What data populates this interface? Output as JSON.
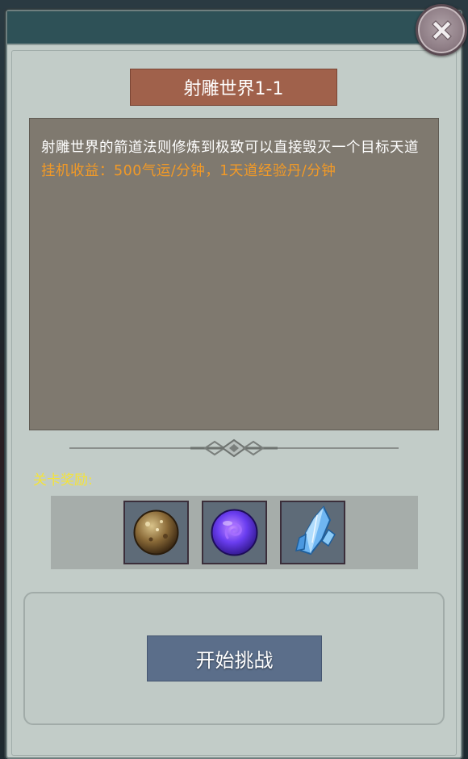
{
  "dialog": {
    "title": "射雕世界1-1",
    "description": "射雕世界的箭道法则修炼到极致可以直接毁灭一个目标天道",
    "income": "挂机收益：500气运/分钟，1天道经验丹/分钟",
    "reward_label": "关卡奖励:",
    "rewards": [
      {
        "icon": "bronze-orb-icon"
      },
      {
        "icon": "purple-orb-icon"
      },
      {
        "icon": "ice-crystal-icon"
      }
    ],
    "start_button": "开始挑战",
    "close_icon": "close-icon"
  },
  "colors": {
    "title_bg": "#a0614b",
    "income_text": "#f39a26",
    "reward_label": "#f4e33a",
    "button_bg": "#5b6e8a",
    "panel_bg": "#c2ccc8",
    "header_bg": "#2e5157"
  }
}
